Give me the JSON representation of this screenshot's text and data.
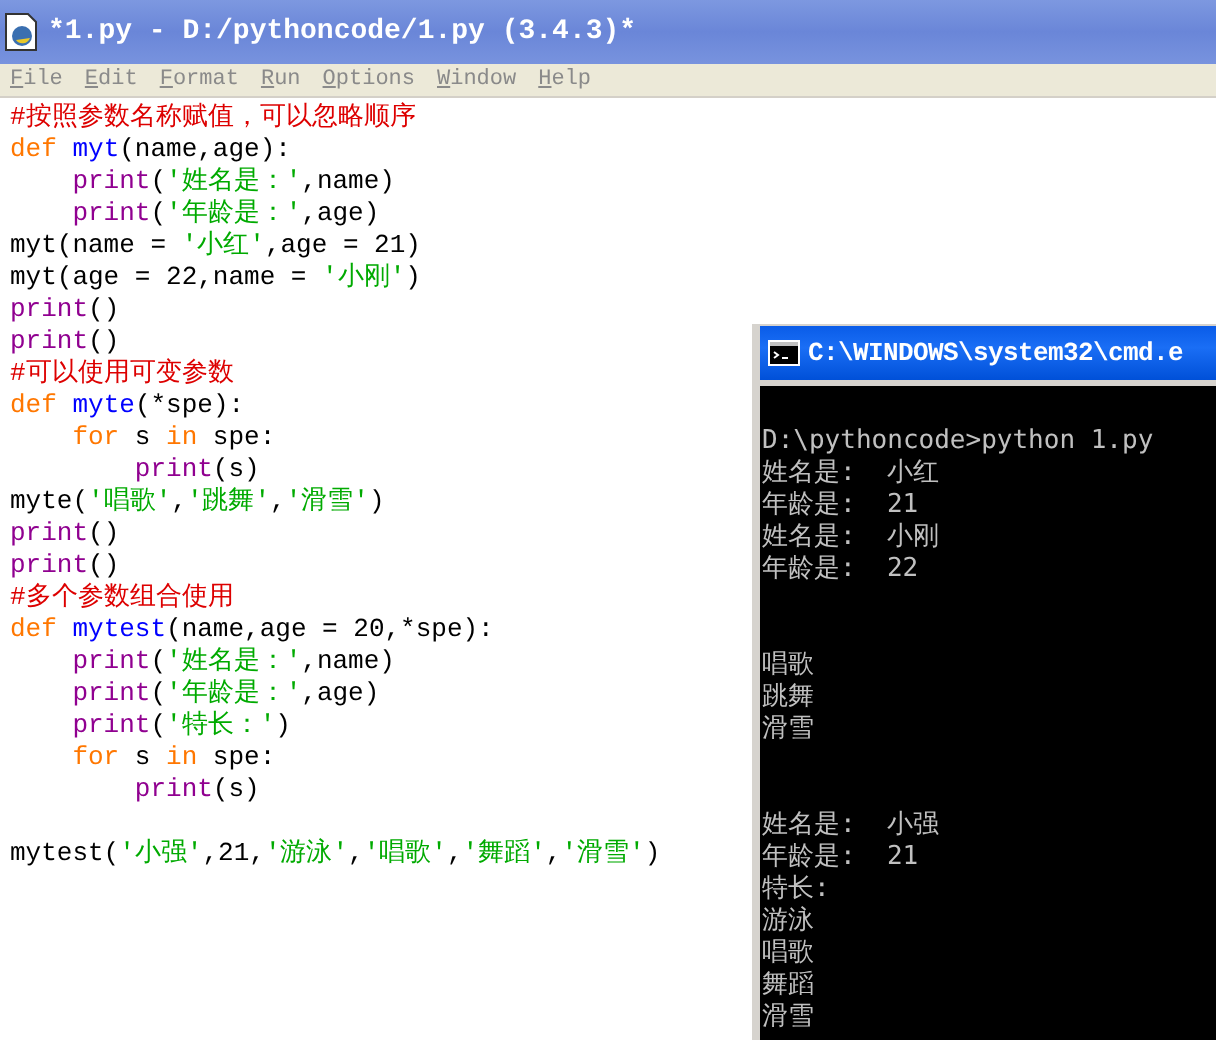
{
  "window": {
    "title": "*1.py - D:/pythoncode/1.py (3.4.3)*"
  },
  "menu": [
    "File",
    "Edit",
    "Format",
    "Run",
    "Options",
    "Window",
    "Help"
  ],
  "code_lines": [
    {
      "kind": "code",
      "tokens": [
        {
          "kind": "comment",
          "text": "#按照参数名称赋值，可以忽略顺序"
        }
      ]
    },
    {
      "kind": "code",
      "tokens": [
        {
          "kind": "keyword",
          "text": "def "
        },
        {
          "kind": "defname",
          "text": "myt"
        },
        {
          "kind": "plain",
          "text": "(name,age):"
        }
      ]
    },
    {
      "kind": "code",
      "tokens": [
        {
          "kind": "builtin",
          "text": "    print"
        },
        {
          "kind": "plain",
          "text": "("
        },
        {
          "kind": "string",
          "text": "'姓名是：'"
        },
        {
          "kind": "plain",
          "text": ",name)"
        }
      ]
    },
    {
      "kind": "code",
      "tokens": [
        {
          "kind": "builtin",
          "text": "    print"
        },
        {
          "kind": "plain",
          "text": "("
        },
        {
          "kind": "string",
          "text": "'年龄是：'"
        },
        {
          "kind": "plain",
          "text": ",age)"
        }
      ]
    },
    {
      "kind": "code",
      "tokens": [
        {
          "kind": "plain",
          "text": "myt(name = "
        },
        {
          "kind": "string",
          "text": "'小红'"
        },
        {
          "kind": "plain",
          "text": ",age = 21)"
        }
      ]
    },
    {
      "kind": "code",
      "tokens": [
        {
          "kind": "plain",
          "text": "myt(age = 22,name = "
        },
        {
          "kind": "string",
          "text": "'小刚'"
        },
        {
          "kind": "plain",
          "text": ")"
        }
      ]
    },
    {
      "kind": "code",
      "tokens": [
        {
          "kind": "builtin",
          "text": "print"
        },
        {
          "kind": "plain",
          "text": "()"
        }
      ]
    },
    {
      "kind": "code",
      "tokens": [
        {
          "kind": "builtin",
          "text": "print"
        },
        {
          "kind": "plain",
          "text": "()"
        }
      ]
    },
    {
      "kind": "code",
      "tokens": [
        {
          "kind": "comment",
          "text": "#可以使用可变参数"
        }
      ]
    },
    {
      "kind": "code",
      "tokens": [
        {
          "kind": "keyword",
          "text": "def "
        },
        {
          "kind": "defname",
          "text": "myte"
        },
        {
          "kind": "plain",
          "text": "(*spe):"
        }
      ]
    },
    {
      "kind": "code",
      "tokens": [
        {
          "kind": "keyword",
          "text": "    for"
        },
        {
          "kind": "plain",
          "text": " s "
        },
        {
          "kind": "keyword",
          "text": "in"
        },
        {
          "kind": "plain",
          "text": " spe:"
        }
      ]
    },
    {
      "kind": "code",
      "tokens": [
        {
          "kind": "builtin",
          "text": "        print"
        },
        {
          "kind": "plain",
          "text": "(s)"
        }
      ]
    },
    {
      "kind": "code",
      "tokens": [
        {
          "kind": "plain",
          "text": "myte("
        },
        {
          "kind": "string",
          "text": "'唱歌'"
        },
        {
          "kind": "plain",
          "text": ","
        },
        {
          "kind": "string",
          "text": "'跳舞'"
        },
        {
          "kind": "plain",
          "text": ","
        },
        {
          "kind": "string",
          "text": "'滑雪'"
        },
        {
          "kind": "plain",
          "text": ")"
        }
      ]
    },
    {
      "kind": "code",
      "tokens": [
        {
          "kind": "builtin",
          "text": "print"
        },
        {
          "kind": "plain",
          "text": "()"
        }
      ]
    },
    {
      "kind": "code",
      "tokens": [
        {
          "kind": "builtin",
          "text": "print"
        },
        {
          "kind": "plain",
          "text": "()"
        }
      ]
    },
    {
      "kind": "code",
      "tokens": [
        {
          "kind": "comment",
          "text": "#多个参数组合使用"
        }
      ]
    },
    {
      "kind": "code",
      "tokens": [
        {
          "kind": "keyword",
          "text": "def "
        },
        {
          "kind": "defname",
          "text": "mytest"
        },
        {
          "kind": "plain",
          "text": "(name,age = 20,*spe):"
        }
      ]
    },
    {
      "kind": "code",
      "tokens": [
        {
          "kind": "builtin",
          "text": "    print"
        },
        {
          "kind": "plain",
          "text": "("
        },
        {
          "kind": "string",
          "text": "'姓名是：'"
        },
        {
          "kind": "plain",
          "text": ",name)"
        }
      ]
    },
    {
      "kind": "code",
      "tokens": [
        {
          "kind": "builtin",
          "text": "    print"
        },
        {
          "kind": "plain",
          "text": "("
        },
        {
          "kind": "string",
          "text": "'年龄是：'"
        },
        {
          "kind": "plain",
          "text": ",age)"
        }
      ]
    },
    {
      "kind": "code",
      "tokens": [
        {
          "kind": "builtin",
          "text": "    print"
        },
        {
          "kind": "plain",
          "text": "("
        },
        {
          "kind": "string",
          "text": "'特长：'"
        },
        {
          "kind": "plain",
          "text": ")"
        }
      ]
    },
    {
      "kind": "code",
      "tokens": [
        {
          "kind": "keyword",
          "text": "    for"
        },
        {
          "kind": "plain",
          "text": " s "
        },
        {
          "kind": "keyword",
          "text": "in"
        },
        {
          "kind": "plain",
          "text": " spe:"
        }
      ]
    },
    {
      "kind": "code",
      "tokens": [
        {
          "kind": "builtin",
          "text": "        print"
        },
        {
          "kind": "plain",
          "text": "(s)"
        }
      ]
    },
    {
      "kind": "blank"
    },
    {
      "kind": "code",
      "tokens": [
        {
          "kind": "plain",
          "text": "mytest("
        },
        {
          "kind": "string",
          "text": "'小强'"
        },
        {
          "kind": "plain",
          "text": ",21,"
        },
        {
          "kind": "string",
          "text": "'游泳'"
        },
        {
          "kind": "plain",
          "text": ","
        },
        {
          "kind": "string",
          "text": "'唱歌'"
        },
        {
          "kind": "plain",
          "text": ","
        },
        {
          "kind": "string",
          "text": "'舞蹈'"
        },
        {
          "kind": "plain",
          "text": ","
        },
        {
          "kind": "string",
          "text": "'滑雪'"
        },
        {
          "kind": "plain",
          "text": ")"
        }
      ]
    }
  ],
  "console": {
    "title": "C:\\WINDOWS\\system32\\cmd.e",
    "lines": [
      {
        "kind": "blank"
      },
      {
        "kind": "text",
        "text": "D:\\pythoncode>python 1.py"
      },
      {
        "kind": "text",
        "text": "姓名是:  小红"
      },
      {
        "kind": "text",
        "text": "年龄是:  21"
      },
      {
        "kind": "text",
        "text": "姓名是:  小刚"
      },
      {
        "kind": "text",
        "text": "年龄是:  22"
      },
      {
        "kind": "blank"
      },
      {
        "kind": "blank"
      },
      {
        "kind": "text",
        "text": "唱歌"
      },
      {
        "kind": "text",
        "text": "跳舞"
      },
      {
        "kind": "text",
        "text": "滑雪"
      },
      {
        "kind": "blank"
      },
      {
        "kind": "blank"
      },
      {
        "kind": "text",
        "text": "姓名是:  小强"
      },
      {
        "kind": "text",
        "text": "年龄是:  21"
      },
      {
        "kind": "text",
        "text": "特长:"
      },
      {
        "kind": "text",
        "text": "游泳"
      },
      {
        "kind": "text",
        "text": "唱歌"
      },
      {
        "kind": "text",
        "text": "舞蹈"
      },
      {
        "kind": "text",
        "text": "滑雪"
      }
    ]
  }
}
